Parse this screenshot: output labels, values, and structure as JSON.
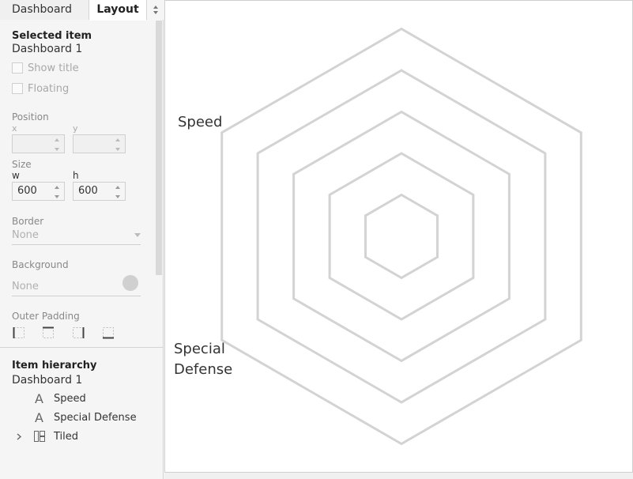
{
  "tabs": {
    "dashboard": "Dashboard",
    "layout": "Layout"
  },
  "selected": {
    "heading": "Selected item",
    "name": "Dashboard 1"
  },
  "options": {
    "show_title": "Show title",
    "floating": "Floating"
  },
  "position": {
    "heading": "Position",
    "x_label": "x",
    "y_label": "y",
    "x_value": "",
    "y_value": ""
  },
  "size": {
    "heading": "Size",
    "w_label": "w",
    "h_label": "h",
    "w_value": "600",
    "h_value": "600"
  },
  "border": {
    "heading": "Border",
    "value": "None"
  },
  "background": {
    "heading": "Background",
    "value": "None",
    "swatch_color": "#d0d0d0"
  },
  "outer_padding": {
    "heading": "Outer Padding",
    "icons": [
      "padding-left-icon",
      "padding-top-icon",
      "padding-right-icon",
      "padding-bottom-icon"
    ]
  },
  "hierarchy": {
    "heading": "Item hierarchy",
    "root": "Dashboard 1",
    "items": [
      {
        "icon": "A",
        "label": "Speed"
      },
      {
        "icon": "A",
        "label": "Special Defense"
      },
      {
        "icon": "tiled-icon",
        "label": "Tiled"
      }
    ]
  },
  "canvas": {
    "labels": {
      "speed": "Speed",
      "special_defense_1": "Special",
      "special_defense_2": "Defense"
    },
    "grid_color": "#d3d3d3",
    "hexagon_levels": [
      1,
      2,
      3,
      4,
      5
    ]
  }
}
